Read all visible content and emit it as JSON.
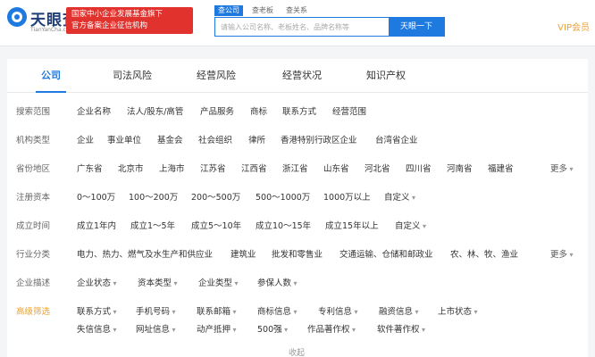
{
  "header": {
    "logo_name": "天眼查",
    "logo_domain": "TianYanCha.com",
    "banner_line1": "国家中小企业发展基金旗下",
    "banner_line2": "官方备案企业征信机构",
    "search_tabs": [
      "查公司",
      "查老板",
      "查关系"
    ],
    "search_placeholder": "请输入公司名称、老板姓名、品牌名称等",
    "search_button": "天眼一下",
    "vip": "VIP会员"
  },
  "tabs": [
    "公司",
    "司法风险",
    "经营风险",
    "经营状况",
    "知识产权"
  ],
  "filters": {
    "scope": {
      "label": "搜索范围",
      "options": [
        "企业名称",
        "法人/股东/高管",
        "产品服务",
        "商标",
        "联系方式",
        "经营范围"
      ]
    },
    "org_type": {
      "label": "机构类型",
      "options": [
        "企业",
        "事业单位",
        "基金会",
        "社会组织",
        "律所",
        "香港特别行政区企业",
        "台湾省企业"
      ]
    },
    "province": {
      "label": "省份地区",
      "options": [
        "广东省",
        "北京市",
        "上海市",
        "江苏省",
        "江西省",
        "浙江省",
        "山东省",
        "河北省",
        "四川省",
        "河南省",
        "福建省"
      ],
      "more": "更多"
    },
    "capital": {
      "label": "注册资本",
      "options": [
        "0～100万",
        "100～200万",
        "200～500万",
        "500～1000万",
        "1000万以上",
        "自定义"
      ]
    },
    "founded": {
      "label": "成立时间",
      "options": [
        "成立1年内",
        "成立1～5年",
        "成立5～10年",
        "成立10～15年",
        "成立15年以上",
        "自定义"
      ]
    },
    "industry": {
      "label": "行业分类",
      "options": [
        "电力、热力、燃气及水生产和供应业",
        "建筑业",
        "批发和零售业",
        "交通运输、仓储和邮政业",
        "农、林、牧、渔业"
      ],
      "more": "更多"
    },
    "description": {
      "label": "企业描述",
      "options": [
        "企业状态",
        "资本类型",
        "企业类型",
        "参保人数"
      ]
    },
    "advanced": {
      "label": "高级筛选",
      "row1": [
        "联系方式",
        "手机号码",
        "联系邮箱",
        "商标信息",
        "专利信息",
        "融资信息",
        "上市状态"
      ],
      "row2": [
        "失信信息",
        "网址信息",
        "动产抵押",
        "500强",
        "作品著作权",
        "软件著作权"
      ]
    }
  },
  "collapse": "收起"
}
